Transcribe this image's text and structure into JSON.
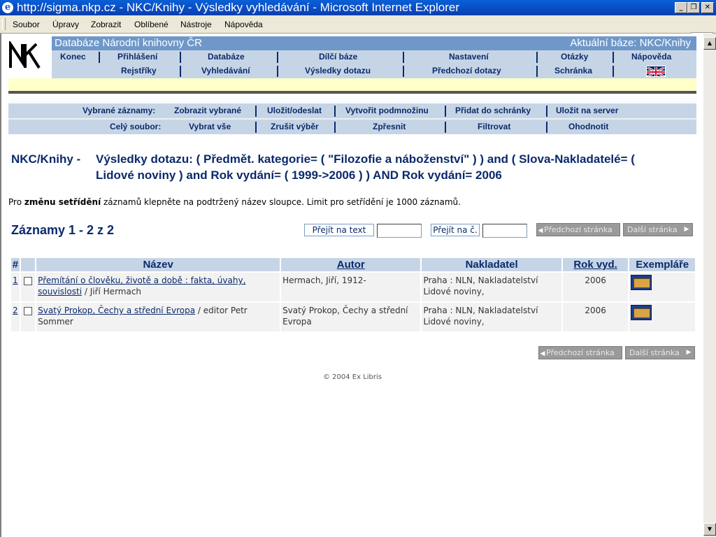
{
  "window": {
    "title": "http://sigma.nkp.cz - NKC/Knihy - Výsledky vyhledávání - Microsoft Internet Explorer",
    "minimize": "_",
    "restore": "❐",
    "close": "✕"
  },
  "menubar": [
    "Soubor",
    "Úpravy",
    "Zobrazit",
    "Oblíbené",
    "Nástroje",
    "Nápověda"
  ],
  "header": {
    "logo": "NK",
    "db_title": "Databáze Národní knihovny ČR",
    "current_db": "Aktuální báze:  NKC/Knihy"
  },
  "nav_row1": [
    "Konec",
    "Přihlášení",
    "Databáze",
    "Dílčí báze",
    "Nastavení",
    "Otázky",
    "Nápověda"
  ],
  "nav_row2": [
    "Rejstříky",
    "Vyhledávání",
    "Výsledky dotazu",
    "Předchozí dotazy",
    "Schránka"
  ],
  "selected": {
    "label": "Vybrané záznamy:",
    "links": [
      "Zobrazit vybrané",
      "Uložit/odeslat",
      "Vytvořit podmnožinu",
      "Přidat do schránky",
      "Uložit na server"
    ]
  },
  "whole": {
    "label": "Celý soubor:",
    "links": [
      "Vybrat vše",
      "Zrušit výběr",
      "Zpřesnit",
      "Filtrovat",
      "Ohodnotit"
    ]
  },
  "heading": {
    "label": "NKC/Knihy -",
    "query": "Výsledky dotazu:  ( Předmět. kategorie= ( \"Filozofie a náboženství\" ) ) and ( Slova-Nakladatelé= ( Lidové noviny ) and Rok vydání= ( 1999->2006 ) ) AND Rok vydání= 2006"
  },
  "sort_note": {
    "pre": "Pro ",
    "bold": "změnu setřídění",
    "post": " záznamů klepněte na podtržený název sloupce. Limit pro setřídění je 1000 záznamů."
  },
  "records_label": "Záznamy 1 - 2 z 2",
  "jump_text_btn": "Přejít na text",
  "jump_num_btn": "Přejít na č.",
  "prev_page": "Předchozí stránka",
  "next_page": "Další stránka",
  "table": {
    "headers": [
      "#",
      "",
      "Název",
      "Autor",
      "Nakladatel",
      "Rok vyd.",
      "Exempláře"
    ],
    "rows": [
      {
        "num": "1",
        "title_link": "Přemítání o člověku, životě a době : fakta, úvahy, souvislosti",
        "title_rest": " / Jiří Hermach",
        "author": "Hermach, Jiří, 1912-",
        "publisher": "Praha : NLN, Nakladatelství Lidové noviny,",
        "year": "2006"
      },
      {
        "num": "2",
        "title_link": "Svatý Prokop, Čechy a střední Evropa",
        "title_rest": " / editor Petr Sommer",
        "author": "Svatý Prokop, Čechy a střední Evropa",
        "publisher": "Praha : NLN, Nakladatelství Lidové noviny,",
        "year": "2006"
      }
    ]
  },
  "footer": "© 2004 Ex Libris"
}
